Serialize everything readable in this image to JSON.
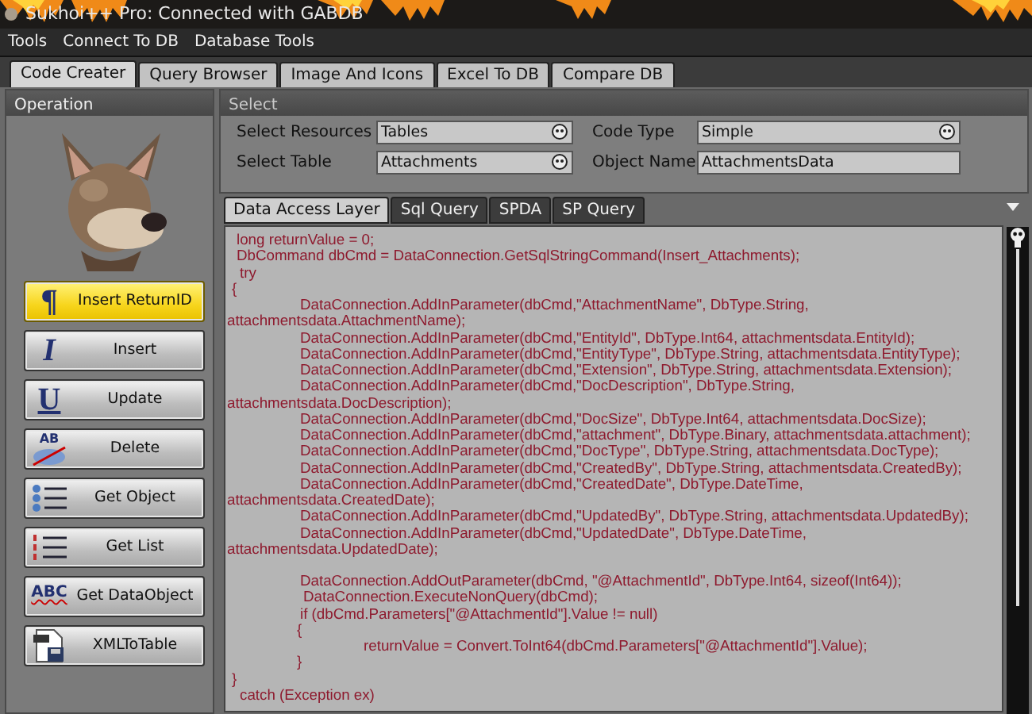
{
  "window": {
    "title": "Sukhoi++ Pro: Connected with GABDB"
  },
  "menu": [
    "Tools",
    "Connect To DB",
    "Database Tools"
  ],
  "tabs": [
    {
      "label": "Code Creater",
      "selected": true
    },
    {
      "label": "Query Browser",
      "selected": false
    },
    {
      "label": "Image And Icons",
      "selected": false
    },
    {
      "label": "Excel To DB",
      "selected": false
    },
    {
      "label": "Compare DB",
      "selected": false
    }
  ],
  "operation": {
    "title": "Operation",
    "buttons": [
      {
        "label": "Insert ReturnID",
        "glyph": "¶",
        "selected": true
      },
      {
        "label": "Insert",
        "glyph": "I",
        "selected": false
      },
      {
        "label": "Update",
        "glyph": "U",
        "selected": false
      },
      {
        "label": "Delete",
        "glyph": "AB",
        "selected": false
      },
      {
        "label": "Get Object",
        "selected": false
      },
      {
        "label": "Get List",
        "selected": false
      },
      {
        "label": "Get DataObject",
        "glyph": "ABC",
        "selected": false
      },
      {
        "label": "XMLToTable",
        "selected": false
      }
    ]
  },
  "select": {
    "title": "Select",
    "fields": [
      {
        "label": "Select Resources",
        "value": "Tables",
        "kind": "dropdown"
      },
      {
        "label": "Code Type",
        "value": "Simple",
        "kind": "dropdown"
      },
      {
        "label": "Select Table",
        "value": "Attachments",
        "kind": "dropdown"
      },
      {
        "label": "Object Name",
        "value": "AttachmentsData",
        "kind": "text"
      }
    ]
  },
  "code_tabs": [
    {
      "label": "Data Access Layer",
      "selected": true
    },
    {
      "label": "Sql Query",
      "selected": false
    },
    {
      "label": "SPDA",
      "selected": false
    },
    {
      "label": "SP Query",
      "selected": false
    }
  ],
  "code_lines": [
    {
      "text": "long returnValue = 0;",
      "kind": "top"
    },
    {
      "text": "DbCommand dbCmd = DataConnection.GetSqlStringCommand(Insert_Attachments);",
      "kind": "top"
    },
    {
      "text": "try",
      "kind": "try"
    },
    {
      "text": "{",
      "kind": "brace"
    },
    {
      "text": "DataConnection.AddInParameter(dbCmd,\"AttachmentName\", DbType.String,",
      "kind": "stmt"
    },
    {
      "text": "attachmentsdata.AttachmentName);",
      "kind": "wrap"
    },
    {
      "text": "DataConnection.AddInParameter(dbCmd,\"EntityId\", DbType.Int64, attachmentsdata.EntityId);",
      "kind": "stmt"
    },
    {
      "text": "DataConnection.AddInParameter(dbCmd,\"EntityType\", DbType.String, attachmentsdata.EntityType);",
      "kind": "stmt"
    },
    {
      "text": "DataConnection.AddInParameter(dbCmd,\"Extension\", DbType.String, attachmentsdata.Extension);",
      "kind": "stmt"
    },
    {
      "text": "DataConnection.AddInParameter(dbCmd,\"DocDescription\", DbType.String,",
      "kind": "stmt"
    },
    {
      "text": "attachmentsdata.DocDescription);",
      "kind": "wrap"
    },
    {
      "text": "DataConnection.AddInParameter(dbCmd,\"DocSize\", DbType.Int64, attachmentsdata.DocSize);",
      "kind": "stmt"
    },
    {
      "text": "DataConnection.AddInParameter(dbCmd,\"attachment\", DbType.Binary, attachmentsdata.attachment);",
      "kind": "stmt"
    },
    {
      "text": "DataConnection.AddInParameter(dbCmd,\"DocType\", DbType.String, attachmentsdata.DocType);",
      "kind": "stmt"
    },
    {
      "text": "DataConnection.AddInParameter(dbCmd,\"CreatedBy\", DbType.String, attachmentsdata.CreatedBy);",
      "kind": "stmt"
    },
    {
      "text": "DataConnection.AddInParameter(dbCmd,\"CreatedDate\", DbType.DateTime,",
      "kind": "stmt"
    },
    {
      "text": "attachmentsdata.CreatedDate);",
      "kind": "wrap"
    },
    {
      "text": "DataConnection.AddInParameter(dbCmd,\"UpdatedBy\", DbType.String, attachmentsdata.UpdatedBy);",
      "kind": "stmt"
    },
    {
      "text": "DataConnection.AddInParameter(dbCmd,\"UpdatedDate\", DbType.DateTime,",
      "kind": "stmt"
    },
    {
      "text": "attachmentsdata.UpdatedDate);",
      "kind": "wrap"
    },
    {
      "text": "DataConnection.AddOutParameter(dbCmd, \"@AttachmentId\", DbType.Int64, sizeof(Int64));",
      "kind": "stmt-gap"
    },
    {
      "text": "DataConnection.ExecuteNonQuery(dbCmd);",
      "kind": "stmt2"
    },
    {
      "text": "if (dbCmd.Parameters[\"@AttachmentId\"].Value != null)",
      "kind": "stmt"
    },
    {
      "text": "{",
      "kind": "inbrace"
    },
    {
      "text": "returnValue = Convert.ToInt64(dbCmd.Parameters[\"@AttachmentId\"].Value);",
      "kind": "inner"
    },
    {
      "text": "}",
      "kind": "inbrace"
    },
    {
      "text": "}",
      "kind": "brace"
    },
    {
      "text": "catch (Exception ex)",
      "kind": "try"
    }
  ]
}
